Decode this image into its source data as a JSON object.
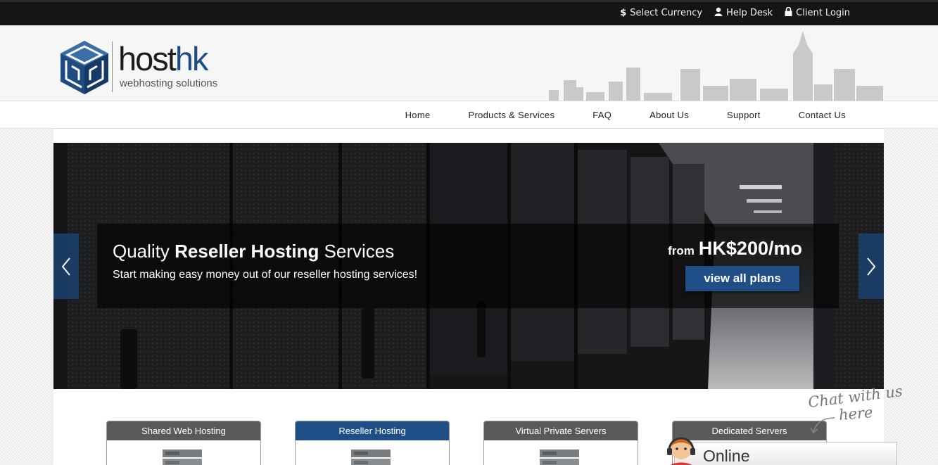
{
  "topbar": {
    "links": [
      {
        "icon": "dollar-icon",
        "glyph": "$",
        "label": "Select Currency"
      },
      {
        "icon": "user-icon",
        "glyph": "☺",
        "label": "Help Desk"
      },
      {
        "icon": "lock-icon",
        "glyph": "🔒",
        "label": "Client Login"
      }
    ]
  },
  "brand": {
    "name_part1": "host",
    "name_part2": "hk",
    "tagline": "webhosting solutions",
    "accent_color": "#1e4c82"
  },
  "nav": {
    "items": [
      "Home",
      "Products & Services",
      "FAQ",
      "About Us",
      "Support",
      "Contact Us"
    ]
  },
  "slider": {
    "title_part1": "Quality ",
    "title_bold": "Reseller Hosting",
    "title_part2": " Services",
    "subtitle": "Start making easy money out of our reseller hosting services!",
    "price_prefix": "from",
    "price": "HK$200/mo",
    "button_label": "view all plans",
    "prev_icon": "chevron-left-icon",
    "next_icon": "chevron-right-icon"
  },
  "products": [
    {
      "label": "Shared Web Hosting",
      "active": false
    },
    {
      "label": "Reseller Hosting",
      "active": true
    },
    {
      "label": "Virtual Private Servers",
      "active": false
    },
    {
      "label": "Dedicated Servers",
      "active": false
    }
  ],
  "chat": {
    "hint_line1": "Chat with us",
    "hint_line2": "here",
    "status": "Online"
  }
}
